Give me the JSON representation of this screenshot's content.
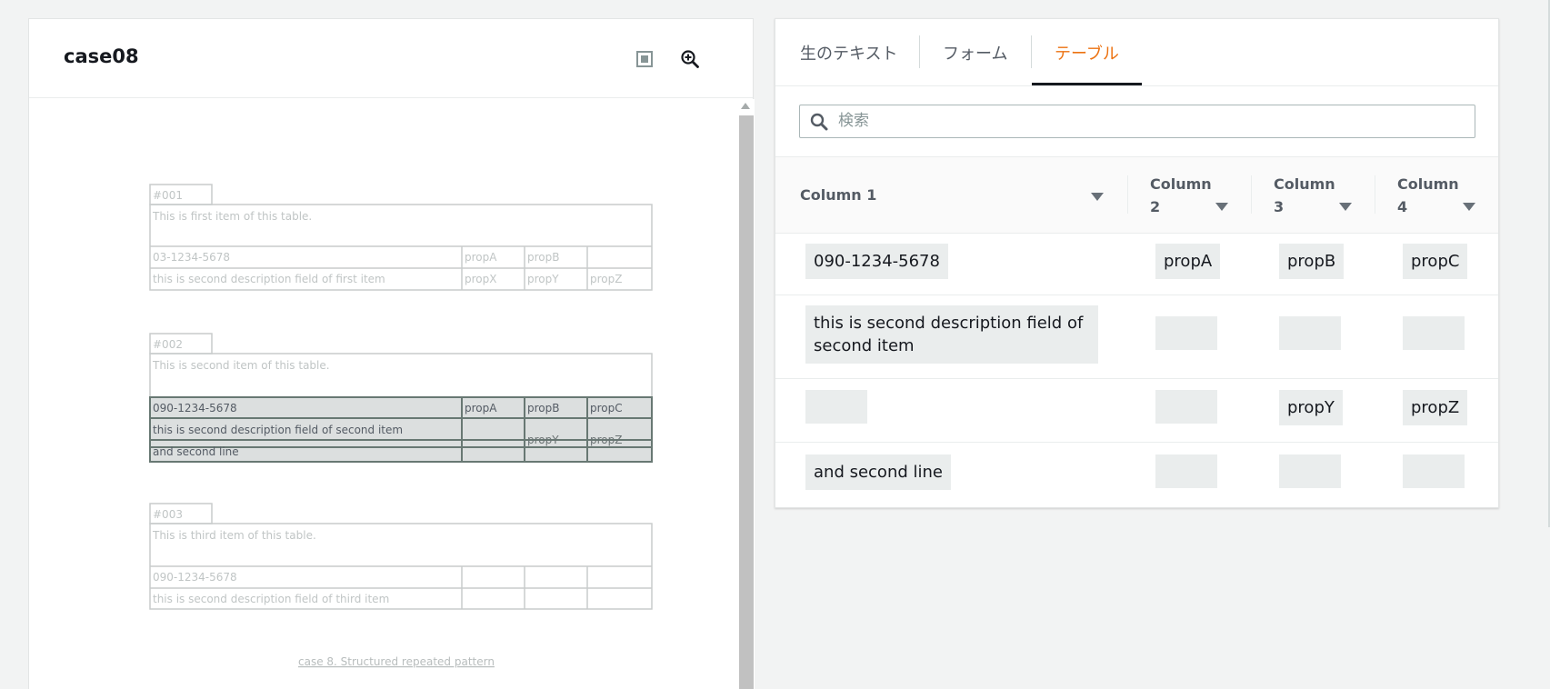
{
  "document": {
    "title": "case08",
    "items": [
      {
        "id": "#001",
        "description": "This is first item of this table.",
        "rows": [
          {
            "c1": "03-1234-5678",
            "c2": "propA",
            "c3": "propB",
            "c4": ""
          },
          {
            "c1": "this is second description field of first item",
            "c2": "propX",
            "c3": "propY",
            "c4": "propZ"
          }
        ]
      },
      {
        "id": "#002",
        "description": "This is second item of this table.",
        "rows": [
          {
            "c1": "090-1234-5678",
            "c2": "propA",
            "c3": "propB",
            "c4": "propC"
          },
          {
            "c1": "this is second description field of second item",
            "c2": "",
            "c3": "propY",
            "c4": "propZ"
          },
          {
            "c1": "and second line",
            "c2": "",
            "c3": "",
            "c4": ""
          }
        ]
      },
      {
        "id": "#003",
        "description": "This is third item of this table.",
        "rows": [
          {
            "c1": "090-1234-5678",
            "c2": "",
            "c3": "",
            "c4": ""
          },
          {
            "c1": "this is second description field of third item",
            "c2": "",
            "c3": "",
            "c4": ""
          }
        ]
      }
    ],
    "caption": "case 8. Structured repeated pattern"
  },
  "tabs": [
    {
      "label": "生のテキスト",
      "active": false
    },
    {
      "label": "フォーム",
      "active": false
    },
    {
      "label": "テーブル",
      "active": true
    }
  ],
  "search": {
    "placeholder": "検索",
    "value": ""
  },
  "table": {
    "headers": [
      {
        "line1": "Column 1",
        "line2": ""
      },
      {
        "line1": "Column",
        "line2": "2"
      },
      {
        "line1": "Column",
        "line2": "3"
      },
      {
        "line1": "Column",
        "line2": "4"
      }
    ],
    "rows": [
      [
        "090-1234-5678",
        "propA",
        "propB",
        "propC"
      ],
      [
        "this is second description field of second item",
        "",
        "",
        ""
      ],
      [
        "",
        "",
        "propY",
        "propZ"
      ],
      [
        "and second line",
        "",
        "",
        ""
      ]
    ]
  },
  "colors": {
    "accent": "#ec7211",
    "highlight_fill": "#dcdfdf",
    "highlight_stroke": "#687873",
    "cell_bg": "#eaeded"
  },
  "icons": [
    "fit-page-icon",
    "zoom-in-icon",
    "search-icon",
    "sort-caret-icon"
  ]
}
